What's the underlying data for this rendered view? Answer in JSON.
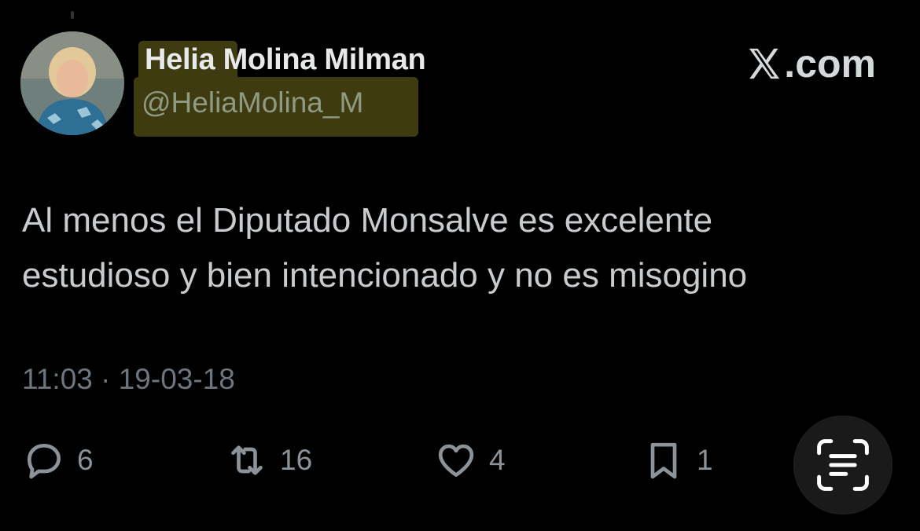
{
  "author": {
    "display_name": "Helia Molina Milman",
    "handle": "@HeliaMolina_M",
    "avatar_icon": "avatar-photo"
  },
  "brand": {
    "label": ".com",
    "logo_icon": "x-logo-icon"
  },
  "tweet": {
    "line_1": "Al menos el Diputado Monsalve es excelente",
    "line_2": "estudioso y bien intencionado y no es misogino",
    "timestamp": "11:03 · 19-03-18"
  },
  "actions": {
    "reply": {
      "icon": "reply-icon",
      "count": "6"
    },
    "retweet": {
      "icon": "retweet-icon",
      "count": "16"
    },
    "like": {
      "icon": "heart-icon",
      "count": "4"
    },
    "bookmark": {
      "icon": "bookmark-icon",
      "count": "1"
    }
  },
  "scan_button": {
    "icon": "text-scan-icon"
  },
  "colors": {
    "background": "#000000",
    "highlight": "#3e3b10",
    "text_primary": "#e7e9ea",
    "text_secondary": "#6e767d"
  }
}
